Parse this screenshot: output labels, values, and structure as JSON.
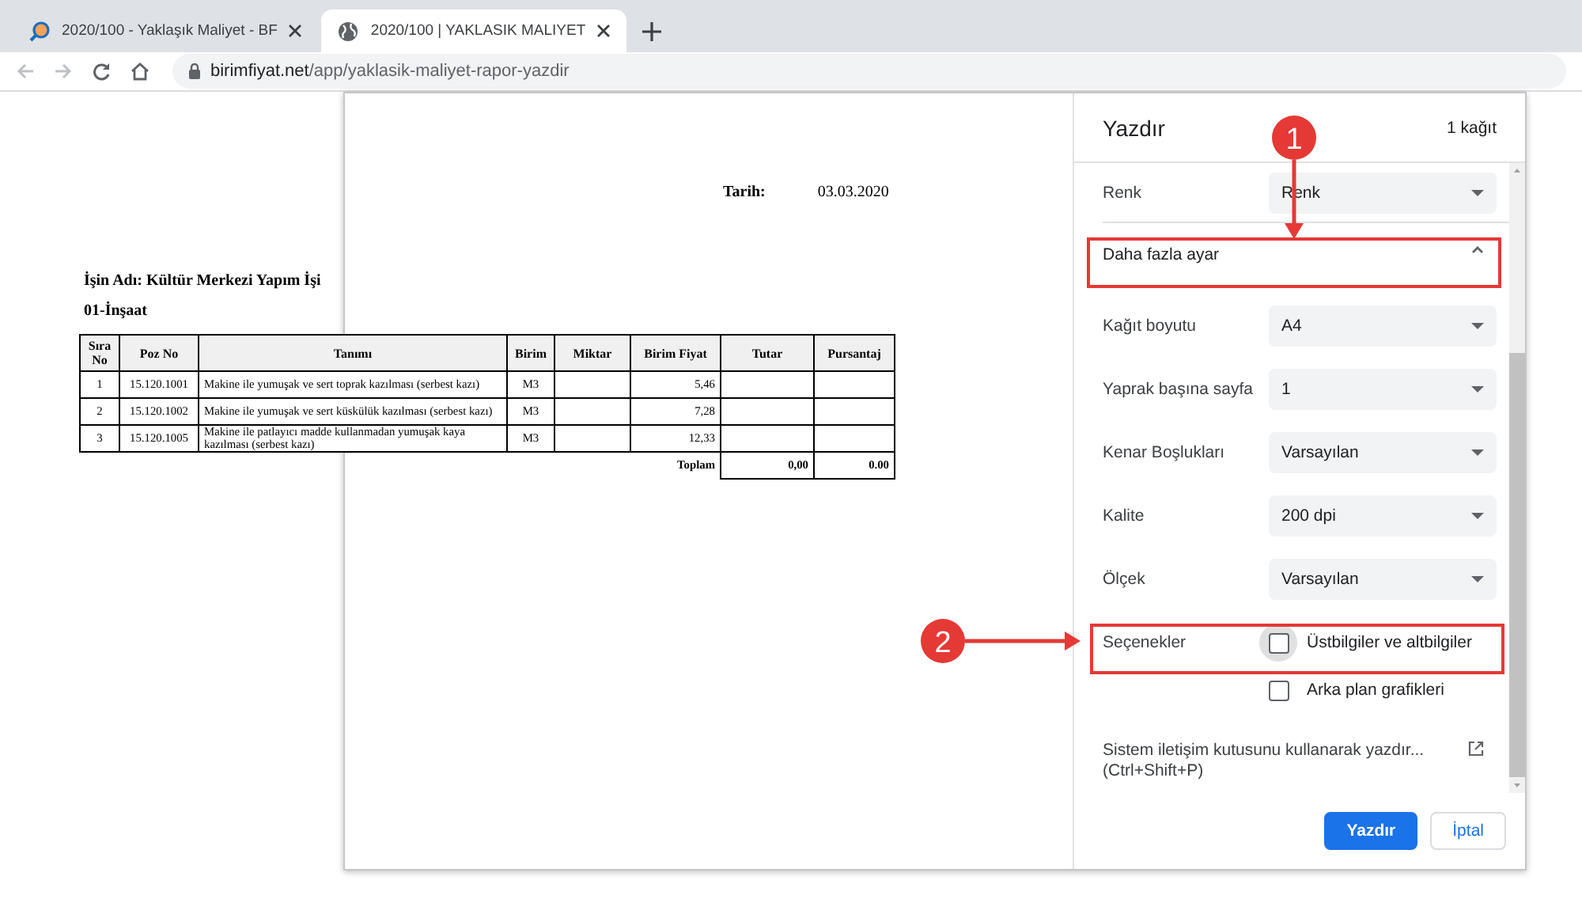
{
  "browser": {
    "tabs": [
      {
        "title": "2020/100 - Yaklaşık Maliyet - BF",
        "selected": false
      },
      {
        "title": "2020/100 | YAKLASIK MALIYET",
        "selected": true
      }
    ],
    "address": {
      "host": "birimfiyat.net",
      "path": "/app/yaklasik-maliyet-rapor-yazdir"
    }
  },
  "document": {
    "date_label": "Tarih:",
    "date": "03.03.2020",
    "job_title": "İşin Adı: Kültür Merkezi Yapım İşi",
    "section": "01-İnşaat",
    "table": {
      "columns": [
        "Sıra No",
        "Poz No",
        "Tanımı",
        "Birim",
        "Miktar",
        "Birim Fiyat",
        "Tutar",
        "Pursantaj"
      ],
      "rows": [
        [
          "1",
          "15.120.1001",
          "Makine ile yumuşak ve sert toprak kazılması (serbest kazı)",
          "M3",
          "",
          "5,46",
          "",
          ""
        ],
        [
          "2",
          "15.120.1002",
          "Makine ile yumuşak ve sert küskülük kazılması (serbest kazı)",
          "M3",
          "",
          "7,28",
          "",
          ""
        ],
        [
          "3",
          "15.120.1005",
          "Makine ile patlayıcı madde kullanmadan yumuşak kaya kazılması (serbest kazı)",
          "M3",
          "",
          "12,33",
          "",
          ""
        ]
      ],
      "total": {
        "label": "Toplam",
        "values": [
          "0,00",
          "0.00"
        ]
      }
    }
  },
  "print_dialog": {
    "title": "Yazdır",
    "sheets": "1 kağıt",
    "settings": [
      {
        "kind": "select",
        "label": "Renk",
        "value": "Renk"
      },
      {
        "kind": "expander",
        "label": "Daha fazla ayar",
        "expanded": true
      },
      {
        "kind": "select",
        "label": "Kağıt boyutu",
        "value": "A4"
      },
      {
        "kind": "select",
        "label": "Yaprak başına sayfa",
        "value": "1"
      },
      {
        "kind": "select",
        "label": "Kenar Boşlukları",
        "value": "Varsayılan"
      },
      {
        "kind": "select",
        "label": "Kalite",
        "value": "200 dpi"
      },
      {
        "kind": "select",
        "label": "Ölçek",
        "value": "Varsayılan"
      },
      {
        "kind": "checkbox",
        "label": "Seçenekler",
        "option": "Üstbilgiler ve altbilgiler",
        "checked": false,
        "focused": true
      },
      {
        "kind": "checkbox",
        "option": "Arka plan grafikleri",
        "checked": false,
        "focused": false
      },
      {
        "kind": "link",
        "label": "Sistem iletişim kutusunu kullanarak yazdır... (Ctrl+Shift+P)"
      }
    ],
    "buttons": [
      {
        "label": "Yazdır",
        "kind": "primary"
      },
      {
        "label": "İptal",
        "kind": "secondary"
      }
    ]
  },
  "annotations": [
    {
      "number": "1"
    },
    {
      "number": "2"
    }
  ]
}
